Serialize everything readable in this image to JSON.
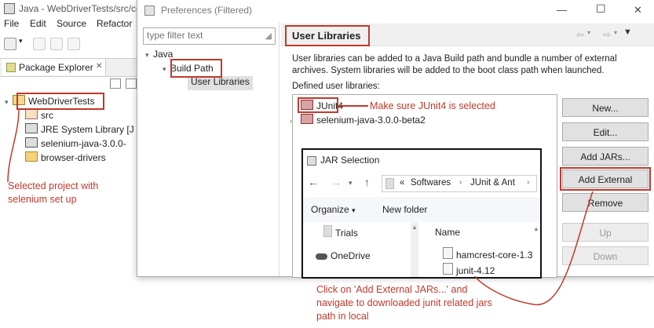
{
  "eclipse": {
    "title": "Java - WebDriverTests/src/co",
    "menu": [
      "File",
      "Edit",
      "Source",
      "Refactor"
    ],
    "package_explorer_tab": "Package Explorer",
    "tab_close": "✕",
    "tree": [
      {
        "label": "WebDriverTests",
        "icon": "project-icon"
      },
      {
        "label": "src",
        "icon": "package-folder-icon"
      },
      {
        "label": "JRE System Library [J",
        "icon": "library-icon"
      },
      {
        "label": "selenium-java-3.0.0-",
        "icon": "library-icon"
      },
      {
        "label": "browser-drivers",
        "icon": "folder-icon"
      }
    ]
  },
  "dialog": {
    "title": "Preferences (Filtered)",
    "filter_placeholder": "type filter text",
    "tree": {
      "root": "Java",
      "child": "Build Path",
      "leaf": "User Libraries"
    },
    "page_title": "User Libraries",
    "description": "User libraries can be added to a Java Build path and bundle a number of external archives. System libraries will be added to the boot class path when launched.",
    "defined_label": "Defined user libraries:",
    "libraries": [
      "JUnit4",
      "selenium-java-3.0.0-beta2"
    ],
    "buttons": {
      "new": "New...",
      "edit": "Edit...",
      "add_jars": "Add JARs...",
      "add_external_jars": "Add External JARs...",
      "remove": "Remove",
      "up": "Up",
      "down": "Down"
    }
  },
  "jar_dialog": {
    "title": "JAR Selection",
    "path": [
      "Softwares",
      "JUnit & Ant"
    ],
    "path_prefix": "«",
    "organize": "Organize",
    "new_folder": "New folder",
    "nav_items": [
      "Trials",
      "OneDrive"
    ],
    "column_name": "Name",
    "files": [
      "hamcrest-core-1.3",
      "junit-4.12"
    ]
  },
  "annotations": {
    "selected_project": "Selected project with selenium set up",
    "junit_note": "Make sure JUnit4 is selected",
    "click_note": "Click on 'Add External JARs...' and navigate to downloaded junit related jars path in local"
  },
  "colors": {
    "annotation": "#c0392b",
    "selection": "#cce8ff"
  }
}
